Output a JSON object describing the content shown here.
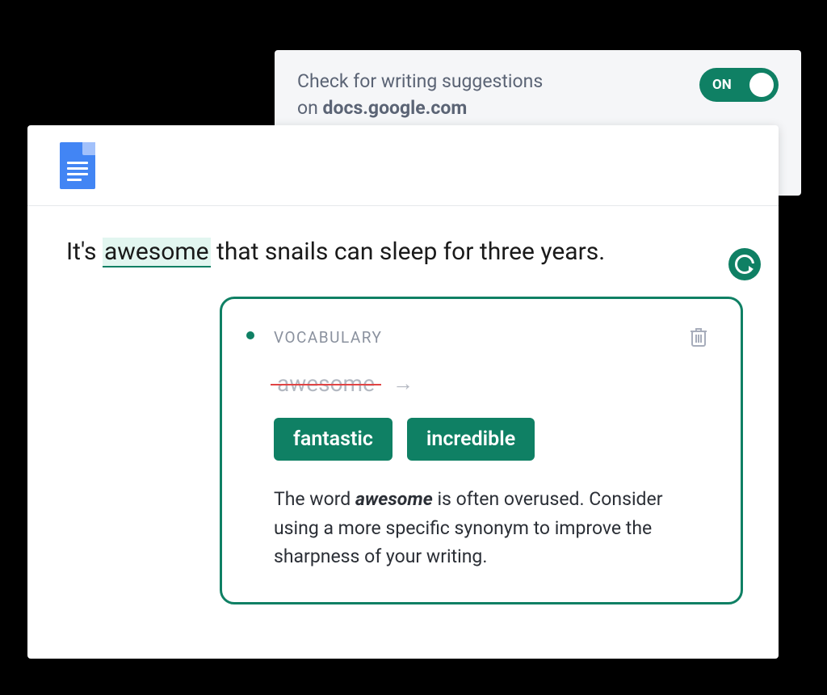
{
  "toggle": {
    "line1": "Check for writing suggestions",
    "line2_prefix": "on ",
    "domain": "docs.google.com",
    "state_label": "ON",
    "enabled": true
  },
  "document": {
    "sentence_before": "It's ",
    "flagged_word": "awesome",
    "sentence_after": " that snails can sleep for three years."
  },
  "suggestion": {
    "category": "VOCABULARY",
    "original_word": "awesome",
    "replacements": [
      "fantastic",
      "incredible"
    ],
    "explanation_pre": "The word ",
    "explanation_em": "awesome",
    "explanation_post": " is often overused. Consider using a more specific synonym to improve the sharpness of your writing."
  },
  "colors": {
    "accent": "#0f8064"
  }
}
